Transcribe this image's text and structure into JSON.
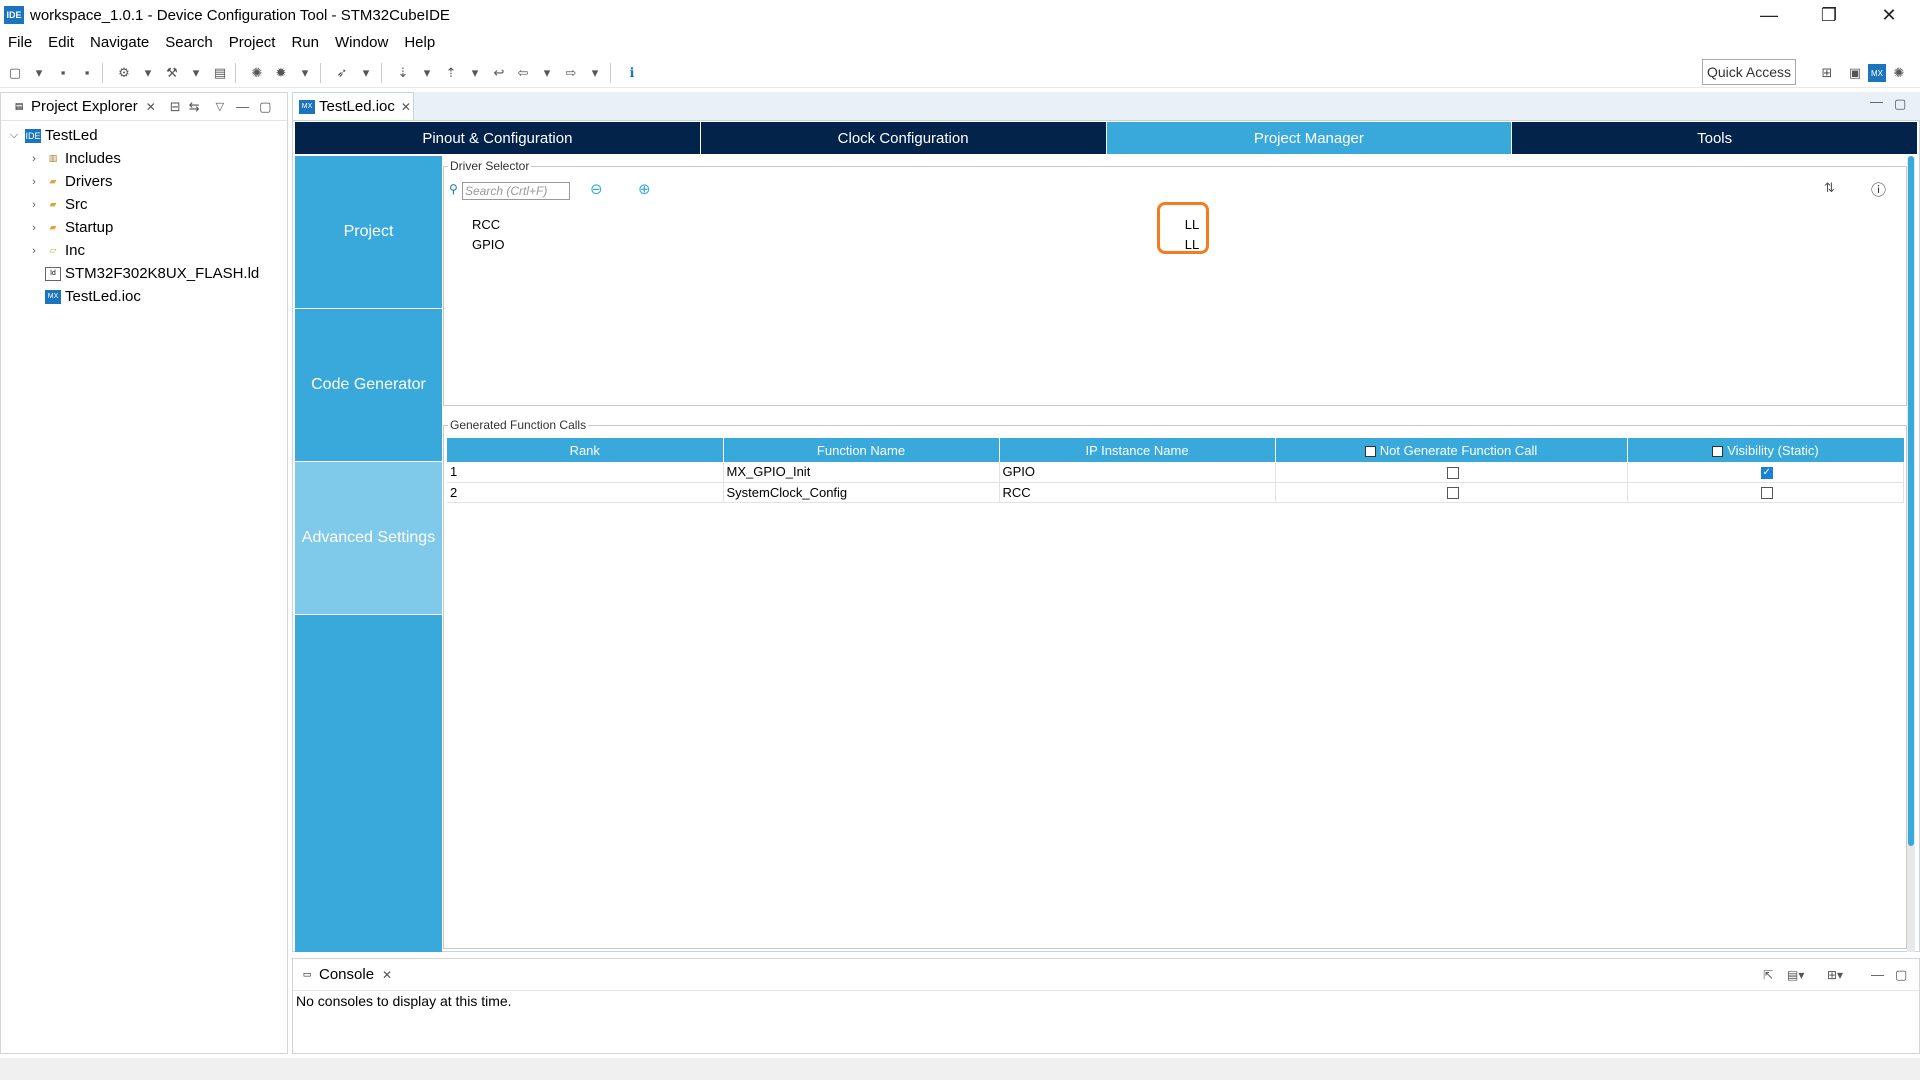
{
  "window": {
    "title": "workspace_1.0.1 - Device Configuration Tool - STM32CubeIDE",
    "app_icon": "IDE",
    "minimize": "—",
    "restore": "❐",
    "close": "✕"
  },
  "menu": [
    "File",
    "Edit",
    "Navigate",
    "Search",
    "Project",
    "Run",
    "Window",
    "Help"
  ],
  "toolbar": {
    "quick_access": "Quick Access"
  },
  "project_explorer": {
    "title": "Project Explorer",
    "items": [
      {
        "label": "TestLed",
        "depth": 0,
        "expanded": true,
        "icon": "project-icon"
      },
      {
        "label": "Includes",
        "depth": 1,
        "icon": "includes-folder-icon"
      },
      {
        "label": "Drivers",
        "depth": 1,
        "icon": "folder-icon"
      },
      {
        "label": "Src",
        "depth": 1,
        "icon": "folder-icon"
      },
      {
        "label": "Startup",
        "depth": 1,
        "icon": "folder-icon"
      },
      {
        "label": "Inc",
        "depth": 1,
        "icon": "open-folder-icon"
      },
      {
        "label": "STM32F302K8UX_FLASH.ld",
        "depth": 1,
        "icon": "ld-file-icon"
      },
      {
        "label": "TestLed.ioc",
        "depth": 1,
        "icon": "mx-file-icon"
      }
    ]
  },
  "editor": {
    "tab_label": "TestLed.ioc",
    "main_tabs": [
      "Pinout & Configuration",
      "Clock Configuration",
      "Project Manager",
      "Tools"
    ],
    "active_main_tab": 2,
    "side_nav": [
      "Project",
      "Code Generator",
      "Advanced Settings"
    ],
    "active_side_nav": 2
  },
  "driver_selector": {
    "title": "Driver Selector",
    "search_placeholder": "Search (Crtl+F)",
    "drivers": [
      {
        "name": "RCC",
        "type": "LL"
      },
      {
        "name": "GPIO",
        "type": "LL"
      }
    ]
  },
  "generated_function_calls": {
    "title": "Generated Function Calls",
    "columns": [
      "Rank",
      "Function Name",
      "IP Instance Name",
      "Not Generate Function Call",
      "Visibility (Static)"
    ],
    "rows": [
      {
        "rank": "1",
        "function": "MX_GPIO_Init",
        "ip": "GPIO",
        "not_generate": false,
        "visibility_static": true
      },
      {
        "rank": "2",
        "function": "SystemClock_Config",
        "ip": "RCC",
        "not_generate": false,
        "visibility_static": false
      }
    ]
  },
  "console": {
    "title": "Console",
    "message": "No consoles to display at this time."
  },
  "colors": {
    "tab_dark": "#03234b",
    "accent_blue": "#39a9dc",
    "highlight_orange": "#f47b20"
  }
}
